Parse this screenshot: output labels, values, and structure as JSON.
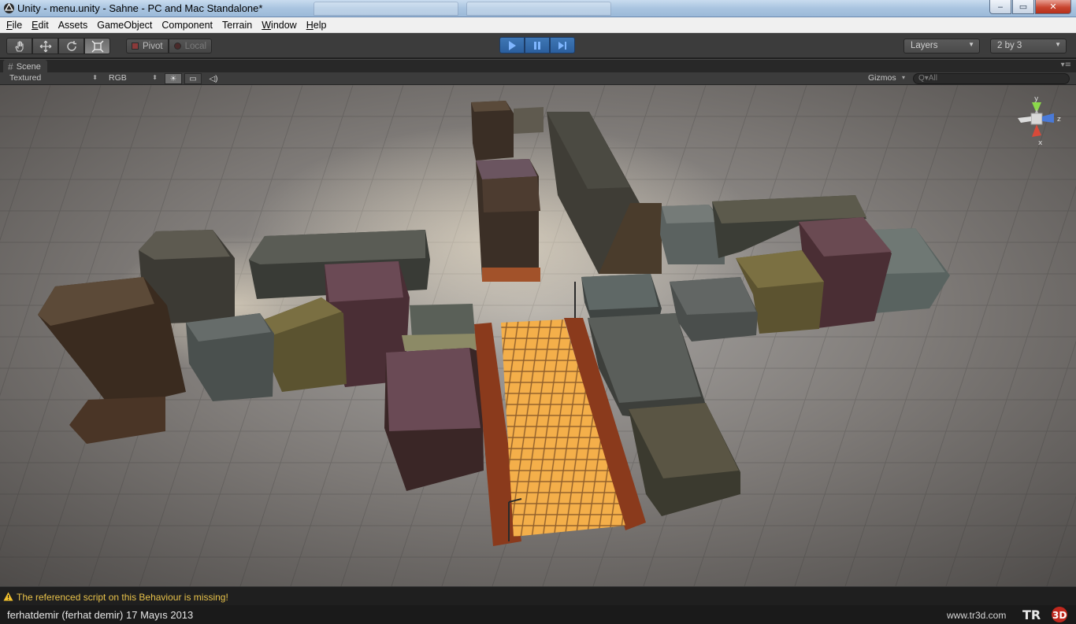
{
  "window": {
    "title": "Unity - menu.unity - Sahne - PC and Mac Standalone*",
    "controls": {
      "minimize": "‒",
      "maximize": "▭",
      "close": "✕"
    }
  },
  "menu": [
    {
      "label": "File",
      "mnemonic": "F",
      "rest": "ile"
    },
    {
      "label": "Edit",
      "mnemonic": "E",
      "rest": "dit"
    },
    {
      "label": "Assets",
      "mnemonic": "",
      "rest": "Assets"
    },
    {
      "label": "GameObject",
      "mnemonic": "",
      "rest": "GameObject"
    },
    {
      "label": "Component",
      "mnemonic": "",
      "rest": "Component"
    },
    {
      "label": "Terrain",
      "mnemonic": "",
      "rest": "Terrain"
    },
    {
      "label": "Window",
      "mnemonic": "W",
      "rest": "indow"
    },
    {
      "label": "Help",
      "mnemonic": "H",
      "rest": "elp"
    }
  ],
  "toolbar": {
    "tools": [
      "hand-icon",
      "move-icon",
      "rotate-icon",
      "scale-icon"
    ],
    "active_tool": "scale-icon",
    "pivot_label": "Pivot",
    "local_label": "Local",
    "play_controls": [
      "play-icon",
      "pause-icon",
      "step-icon"
    ],
    "layers_label": "Layers",
    "layout_label": "2 by 3"
  },
  "scene": {
    "tab_label": "Scene",
    "render_mode": "Textured",
    "color_mode": "RGB",
    "gizmos_label": "Gizmos",
    "search_placeholder": "Q▾All",
    "gizmo_axes": {
      "y": "y",
      "z": "z",
      "x": "x"
    }
  },
  "status": {
    "message": "The referenced script on this Behaviour is missing!",
    "warning_color": "#e8c24a"
  },
  "credits": {
    "author": "ferhatdemir (ferhat demir)  17 Mayıs 2013",
    "site": "www.tr3d.com",
    "logo_text": "TR3D"
  }
}
